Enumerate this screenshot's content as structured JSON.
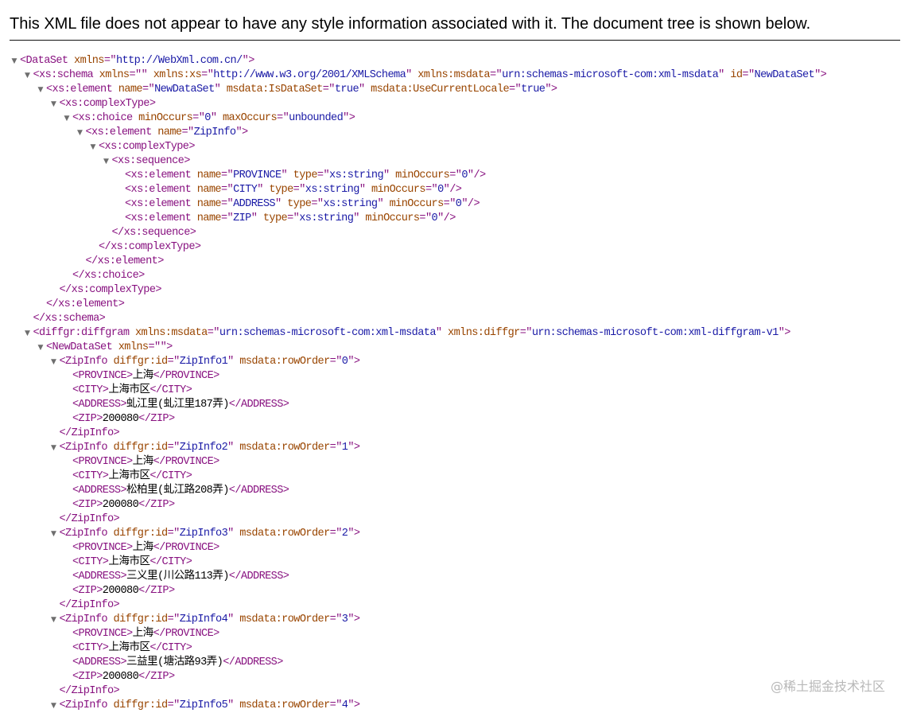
{
  "header": {
    "message": "This XML file does not appear to have any style information associated with it. The document tree is shown below."
  },
  "colors": {
    "tag": "#881280",
    "attribute_name": "#994500",
    "attribute_value": "#1a1aa6",
    "text": "#000000",
    "toggle": "#6e6e6e"
  },
  "icons": {
    "expanded_toggle": "triangle-down-icon"
  },
  "watermark": {
    "text": "@稀土掘金技术社区"
  },
  "tree": [
    {
      "depth": 0,
      "toggle": true,
      "parts": [
        [
          "tag",
          "<DataSet "
        ],
        [
          "an",
          "xmlns"
        ],
        [
          "tag",
          "=\""
        ],
        [
          "av",
          "http://WebXml.com.cn/"
        ],
        [
          "tag",
          "\">"
        ]
      ]
    },
    {
      "depth": 1,
      "toggle": true,
      "parts": [
        [
          "tag",
          "<xs:schema "
        ],
        [
          "an",
          "xmlns"
        ],
        [
          "tag",
          "=\""
        ],
        [
          "av",
          ""
        ],
        [
          "tag",
          "\" "
        ],
        [
          "an",
          "xmlns:xs"
        ],
        [
          "tag",
          "=\""
        ],
        [
          "av",
          "http://www.w3.org/2001/XMLSchema"
        ],
        [
          "tag",
          "\" "
        ],
        [
          "an",
          "xmlns:msdata"
        ],
        [
          "tag",
          "=\""
        ],
        [
          "av",
          "urn:schemas-microsoft-com:xml-msdata"
        ],
        [
          "tag",
          "\" "
        ],
        [
          "an",
          "id"
        ],
        [
          "tag",
          "=\""
        ],
        [
          "av",
          "NewDataSet"
        ],
        [
          "tag",
          "\">"
        ]
      ]
    },
    {
      "depth": 2,
      "toggle": true,
      "parts": [
        [
          "tag",
          "<xs:element "
        ],
        [
          "an",
          "name"
        ],
        [
          "tag",
          "=\""
        ],
        [
          "av",
          "NewDataSet"
        ],
        [
          "tag",
          "\" "
        ],
        [
          "an",
          "msdata:IsDataSet"
        ],
        [
          "tag",
          "=\""
        ],
        [
          "av",
          "true"
        ],
        [
          "tag",
          "\" "
        ],
        [
          "an",
          "msdata:UseCurrentLocale"
        ],
        [
          "tag",
          "=\""
        ],
        [
          "av",
          "true"
        ],
        [
          "tag",
          "\">"
        ]
      ]
    },
    {
      "depth": 3,
      "toggle": true,
      "parts": [
        [
          "tag",
          "<xs:complexType>"
        ]
      ]
    },
    {
      "depth": 4,
      "toggle": true,
      "parts": [
        [
          "tag",
          "<xs:choice "
        ],
        [
          "an",
          "minOccurs"
        ],
        [
          "tag",
          "=\""
        ],
        [
          "av",
          "0"
        ],
        [
          "tag",
          "\" "
        ],
        [
          "an",
          "maxOccurs"
        ],
        [
          "tag",
          "=\""
        ],
        [
          "av",
          "unbounded"
        ],
        [
          "tag",
          "\">"
        ]
      ]
    },
    {
      "depth": 5,
      "toggle": true,
      "parts": [
        [
          "tag",
          "<xs:element "
        ],
        [
          "an",
          "name"
        ],
        [
          "tag",
          "=\""
        ],
        [
          "av",
          "ZipInfo"
        ],
        [
          "tag",
          "\">"
        ]
      ]
    },
    {
      "depth": 6,
      "toggle": true,
      "parts": [
        [
          "tag",
          "<xs:complexType>"
        ]
      ]
    },
    {
      "depth": 7,
      "toggle": true,
      "parts": [
        [
          "tag",
          "<xs:sequence>"
        ]
      ]
    },
    {
      "depth": 8,
      "toggle": false,
      "parts": [
        [
          "tag",
          "<xs:element "
        ],
        [
          "an",
          "name"
        ],
        [
          "tag",
          "=\""
        ],
        [
          "av",
          "PROVINCE"
        ],
        [
          "tag",
          "\" "
        ],
        [
          "an",
          "type"
        ],
        [
          "tag",
          "=\""
        ],
        [
          "av",
          "xs:string"
        ],
        [
          "tag",
          "\" "
        ],
        [
          "an",
          "minOccurs"
        ],
        [
          "tag",
          "=\""
        ],
        [
          "av",
          "0"
        ],
        [
          "tag",
          "\"/>"
        ]
      ]
    },
    {
      "depth": 8,
      "toggle": false,
      "parts": [
        [
          "tag",
          "<xs:element "
        ],
        [
          "an",
          "name"
        ],
        [
          "tag",
          "=\""
        ],
        [
          "av",
          "CITY"
        ],
        [
          "tag",
          "\" "
        ],
        [
          "an",
          "type"
        ],
        [
          "tag",
          "=\""
        ],
        [
          "av",
          "xs:string"
        ],
        [
          "tag",
          "\" "
        ],
        [
          "an",
          "minOccurs"
        ],
        [
          "tag",
          "=\""
        ],
        [
          "av",
          "0"
        ],
        [
          "tag",
          "\"/>"
        ]
      ]
    },
    {
      "depth": 8,
      "toggle": false,
      "parts": [
        [
          "tag",
          "<xs:element "
        ],
        [
          "an",
          "name"
        ],
        [
          "tag",
          "=\""
        ],
        [
          "av",
          "ADDRESS"
        ],
        [
          "tag",
          "\" "
        ],
        [
          "an",
          "type"
        ],
        [
          "tag",
          "=\""
        ],
        [
          "av",
          "xs:string"
        ],
        [
          "tag",
          "\" "
        ],
        [
          "an",
          "minOccurs"
        ],
        [
          "tag",
          "=\""
        ],
        [
          "av",
          "0"
        ],
        [
          "tag",
          "\"/>"
        ]
      ]
    },
    {
      "depth": 8,
      "toggle": false,
      "parts": [
        [
          "tag",
          "<xs:element "
        ],
        [
          "an",
          "name"
        ],
        [
          "tag",
          "=\""
        ],
        [
          "av",
          "ZIP"
        ],
        [
          "tag",
          "\" "
        ],
        [
          "an",
          "type"
        ],
        [
          "tag",
          "=\""
        ],
        [
          "av",
          "xs:string"
        ],
        [
          "tag",
          "\" "
        ],
        [
          "an",
          "minOccurs"
        ],
        [
          "tag",
          "=\""
        ],
        [
          "av",
          "0"
        ],
        [
          "tag",
          "\"/>"
        ]
      ]
    },
    {
      "depth": 7,
      "toggle": false,
      "parts": [
        [
          "tag",
          "</xs:sequence>"
        ]
      ]
    },
    {
      "depth": 6,
      "toggle": false,
      "parts": [
        [
          "tag",
          "</xs:complexType>"
        ]
      ]
    },
    {
      "depth": 5,
      "toggle": false,
      "parts": [
        [
          "tag",
          "</xs:element>"
        ]
      ]
    },
    {
      "depth": 4,
      "toggle": false,
      "parts": [
        [
          "tag",
          "</xs:choice>"
        ]
      ]
    },
    {
      "depth": 3,
      "toggle": false,
      "parts": [
        [
          "tag",
          "</xs:complexType>"
        ]
      ]
    },
    {
      "depth": 2,
      "toggle": false,
      "parts": [
        [
          "tag",
          "</xs:element>"
        ]
      ]
    },
    {
      "depth": 1,
      "toggle": false,
      "parts": [
        [
          "tag",
          "</xs:schema>"
        ]
      ]
    },
    {
      "depth": 1,
      "toggle": true,
      "parts": [
        [
          "tag",
          "<diffgr:diffgram "
        ],
        [
          "an",
          "xmlns:msdata"
        ],
        [
          "tag",
          "=\""
        ],
        [
          "av",
          "urn:schemas-microsoft-com:xml-msdata"
        ],
        [
          "tag",
          "\" "
        ],
        [
          "an",
          "xmlns:diffgr"
        ],
        [
          "tag",
          "=\""
        ],
        [
          "av",
          "urn:schemas-microsoft-com:xml-diffgram-v1"
        ],
        [
          "tag",
          "\">"
        ]
      ]
    },
    {
      "depth": 2,
      "toggle": true,
      "parts": [
        [
          "tag",
          "<NewDataSet "
        ],
        [
          "an",
          "xmlns"
        ],
        [
          "tag",
          "=\""
        ],
        [
          "av",
          ""
        ],
        [
          "tag",
          "\">"
        ]
      ]
    },
    {
      "depth": 3,
      "toggle": true,
      "parts": [
        [
          "tag",
          "<ZipInfo "
        ],
        [
          "an",
          "diffgr:id"
        ],
        [
          "tag",
          "=\""
        ],
        [
          "av",
          "ZipInfo1"
        ],
        [
          "tag",
          "\" "
        ],
        [
          "an",
          "msdata:rowOrder"
        ],
        [
          "tag",
          "=\""
        ],
        [
          "av",
          "0"
        ],
        [
          "tag",
          "\">"
        ]
      ]
    },
    {
      "depth": 4,
      "toggle": false,
      "parts": [
        [
          "tag",
          "<PROVINCE>"
        ],
        [
          "tx",
          "上海"
        ],
        [
          "tag",
          "</PROVINCE>"
        ]
      ]
    },
    {
      "depth": 4,
      "toggle": false,
      "parts": [
        [
          "tag",
          "<CITY>"
        ],
        [
          "tx",
          "上海市区"
        ],
        [
          "tag",
          "</CITY>"
        ]
      ]
    },
    {
      "depth": 4,
      "toggle": false,
      "parts": [
        [
          "tag",
          "<ADDRESS>"
        ],
        [
          "tx",
          "虬江里(虬江里187弄)"
        ],
        [
          "tag",
          "</ADDRESS>"
        ]
      ]
    },
    {
      "depth": 4,
      "toggle": false,
      "parts": [
        [
          "tag",
          "<ZIP>"
        ],
        [
          "tx",
          "200080"
        ],
        [
          "tag",
          "</ZIP>"
        ]
      ]
    },
    {
      "depth": 3,
      "toggle": false,
      "parts": [
        [
          "tag",
          "</ZipInfo>"
        ]
      ]
    },
    {
      "depth": 3,
      "toggle": true,
      "parts": [
        [
          "tag",
          "<ZipInfo "
        ],
        [
          "an",
          "diffgr:id"
        ],
        [
          "tag",
          "=\""
        ],
        [
          "av",
          "ZipInfo2"
        ],
        [
          "tag",
          "\" "
        ],
        [
          "an",
          "msdata:rowOrder"
        ],
        [
          "tag",
          "=\""
        ],
        [
          "av",
          "1"
        ],
        [
          "tag",
          "\">"
        ]
      ]
    },
    {
      "depth": 4,
      "toggle": false,
      "parts": [
        [
          "tag",
          "<PROVINCE>"
        ],
        [
          "tx",
          "上海"
        ],
        [
          "tag",
          "</PROVINCE>"
        ]
      ]
    },
    {
      "depth": 4,
      "toggle": false,
      "parts": [
        [
          "tag",
          "<CITY>"
        ],
        [
          "tx",
          "上海市区"
        ],
        [
          "tag",
          "</CITY>"
        ]
      ]
    },
    {
      "depth": 4,
      "toggle": false,
      "parts": [
        [
          "tag",
          "<ADDRESS>"
        ],
        [
          "tx",
          "松柏里(虬江路208弄)"
        ],
        [
          "tag",
          "</ADDRESS>"
        ]
      ]
    },
    {
      "depth": 4,
      "toggle": false,
      "parts": [
        [
          "tag",
          "<ZIP>"
        ],
        [
          "tx",
          "200080"
        ],
        [
          "tag",
          "</ZIP>"
        ]
      ]
    },
    {
      "depth": 3,
      "toggle": false,
      "parts": [
        [
          "tag",
          "</ZipInfo>"
        ]
      ]
    },
    {
      "depth": 3,
      "toggle": true,
      "parts": [
        [
          "tag",
          "<ZipInfo "
        ],
        [
          "an",
          "diffgr:id"
        ],
        [
          "tag",
          "=\""
        ],
        [
          "av",
          "ZipInfo3"
        ],
        [
          "tag",
          "\" "
        ],
        [
          "an",
          "msdata:rowOrder"
        ],
        [
          "tag",
          "=\""
        ],
        [
          "av",
          "2"
        ],
        [
          "tag",
          "\">"
        ]
      ]
    },
    {
      "depth": 4,
      "toggle": false,
      "parts": [
        [
          "tag",
          "<PROVINCE>"
        ],
        [
          "tx",
          "上海"
        ],
        [
          "tag",
          "</PROVINCE>"
        ]
      ]
    },
    {
      "depth": 4,
      "toggle": false,
      "parts": [
        [
          "tag",
          "<CITY>"
        ],
        [
          "tx",
          "上海市区"
        ],
        [
          "tag",
          "</CITY>"
        ]
      ]
    },
    {
      "depth": 4,
      "toggle": false,
      "parts": [
        [
          "tag",
          "<ADDRESS>"
        ],
        [
          "tx",
          "三义里(川公路113弄)"
        ],
        [
          "tag",
          "</ADDRESS>"
        ]
      ]
    },
    {
      "depth": 4,
      "toggle": false,
      "parts": [
        [
          "tag",
          "<ZIP>"
        ],
        [
          "tx",
          "200080"
        ],
        [
          "tag",
          "</ZIP>"
        ]
      ]
    },
    {
      "depth": 3,
      "toggle": false,
      "parts": [
        [
          "tag",
          "</ZipInfo>"
        ]
      ]
    },
    {
      "depth": 3,
      "toggle": true,
      "parts": [
        [
          "tag",
          "<ZipInfo "
        ],
        [
          "an",
          "diffgr:id"
        ],
        [
          "tag",
          "=\""
        ],
        [
          "av",
          "ZipInfo4"
        ],
        [
          "tag",
          "\" "
        ],
        [
          "an",
          "msdata:rowOrder"
        ],
        [
          "tag",
          "=\""
        ],
        [
          "av",
          "3"
        ],
        [
          "tag",
          "\">"
        ]
      ]
    },
    {
      "depth": 4,
      "toggle": false,
      "parts": [
        [
          "tag",
          "<PROVINCE>"
        ],
        [
          "tx",
          "上海"
        ],
        [
          "tag",
          "</PROVINCE>"
        ]
      ]
    },
    {
      "depth": 4,
      "toggle": false,
      "parts": [
        [
          "tag",
          "<CITY>"
        ],
        [
          "tx",
          "上海市区"
        ],
        [
          "tag",
          "</CITY>"
        ]
      ]
    },
    {
      "depth": 4,
      "toggle": false,
      "parts": [
        [
          "tag",
          "<ADDRESS>"
        ],
        [
          "tx",
          "三益里(塘沽路93弄)"
        ],
        [
          "tag",
          "</ADDRESS>"
        ]
      ]
    },
    {
      "depth": 4,
      "toggle": false,
      "parts": [
        [
          "tag",
          "<ZIP>"
        ],
        [
          "tx",
          "200080"
        ],
        [
          "tag",
          "</ZIP>"
        ]
      ]
    },
    {
      "depth": 3,
      "toggle": false,
      "parts": [
        [
          "tag",
          "</ZipInfo>"
        ]
      ]
    },
    {
      "depth": 3,
      "toggle": true,
      "parts": [
        [
          "tag",
          "<ZipInfo "
        ],
        [
          "an",
          "diffgr:id"
        ],
        [
          "tag",
          "=\""
        ],
        [
          "av",
          "ZipInfo5"
        ],
        [
          "tag",
          "\" "
        ],
        [
          "an",
          "msdata:rowOrder"
        ],
        [
          "tag",
          "=\""
        ],
        [
          "av",
          "4"
        ],
        [
          "tag",
          "\">"
        ]
      ]
    }
  ]
}
